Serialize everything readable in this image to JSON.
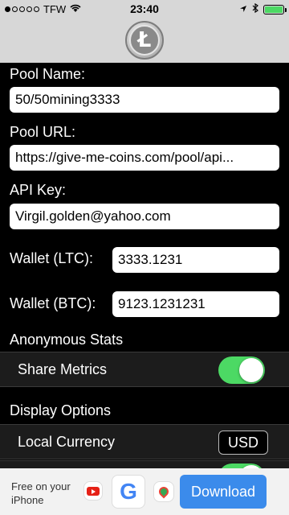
{
  "status_bar": {
    "carrier": "TFW",
    "time": "23:40"
  },
  "form": {
    "pool_name_label": "Pool Name:",
    "pool_name_value": "50/50mining3333",
    "pool_url_label": "Pool URL:",
    "pool_url_value": "https://give-me-coins.com/pool/api...",
    "api_key_label": "API Key:",
    "api_key_value": "Virgil.golden@yahoo.com",
    "wallet_ltc_label": "Wallet (LTC):",
    "wallet_ltc_value": "3333.1231",
    "wallet_btc_label": "Wallet (BTC):",
    "wallet_btc_value": "9123.1231231"
  },
  "anonymous_stats": {
    "title": "Anonymous Stats",
    "share_metrics_label": "Share Metrics",
    "share_metrics_on": true
  },
  "display_options": {
    "title": "Display Options",
    "local_currency_label": "Local Currency",
    "local_currency_value": "USD"
  },
  "ad": {
    "text": "Free on your iPhone",
    "google_letter": "G",
    "download_label": "Download"
  },
  "colors": {
    "toggle_on": "#4cd964",
    "download_button": "#3b8beb",
    "header_bg": "#d7d7d7"
  }
}
